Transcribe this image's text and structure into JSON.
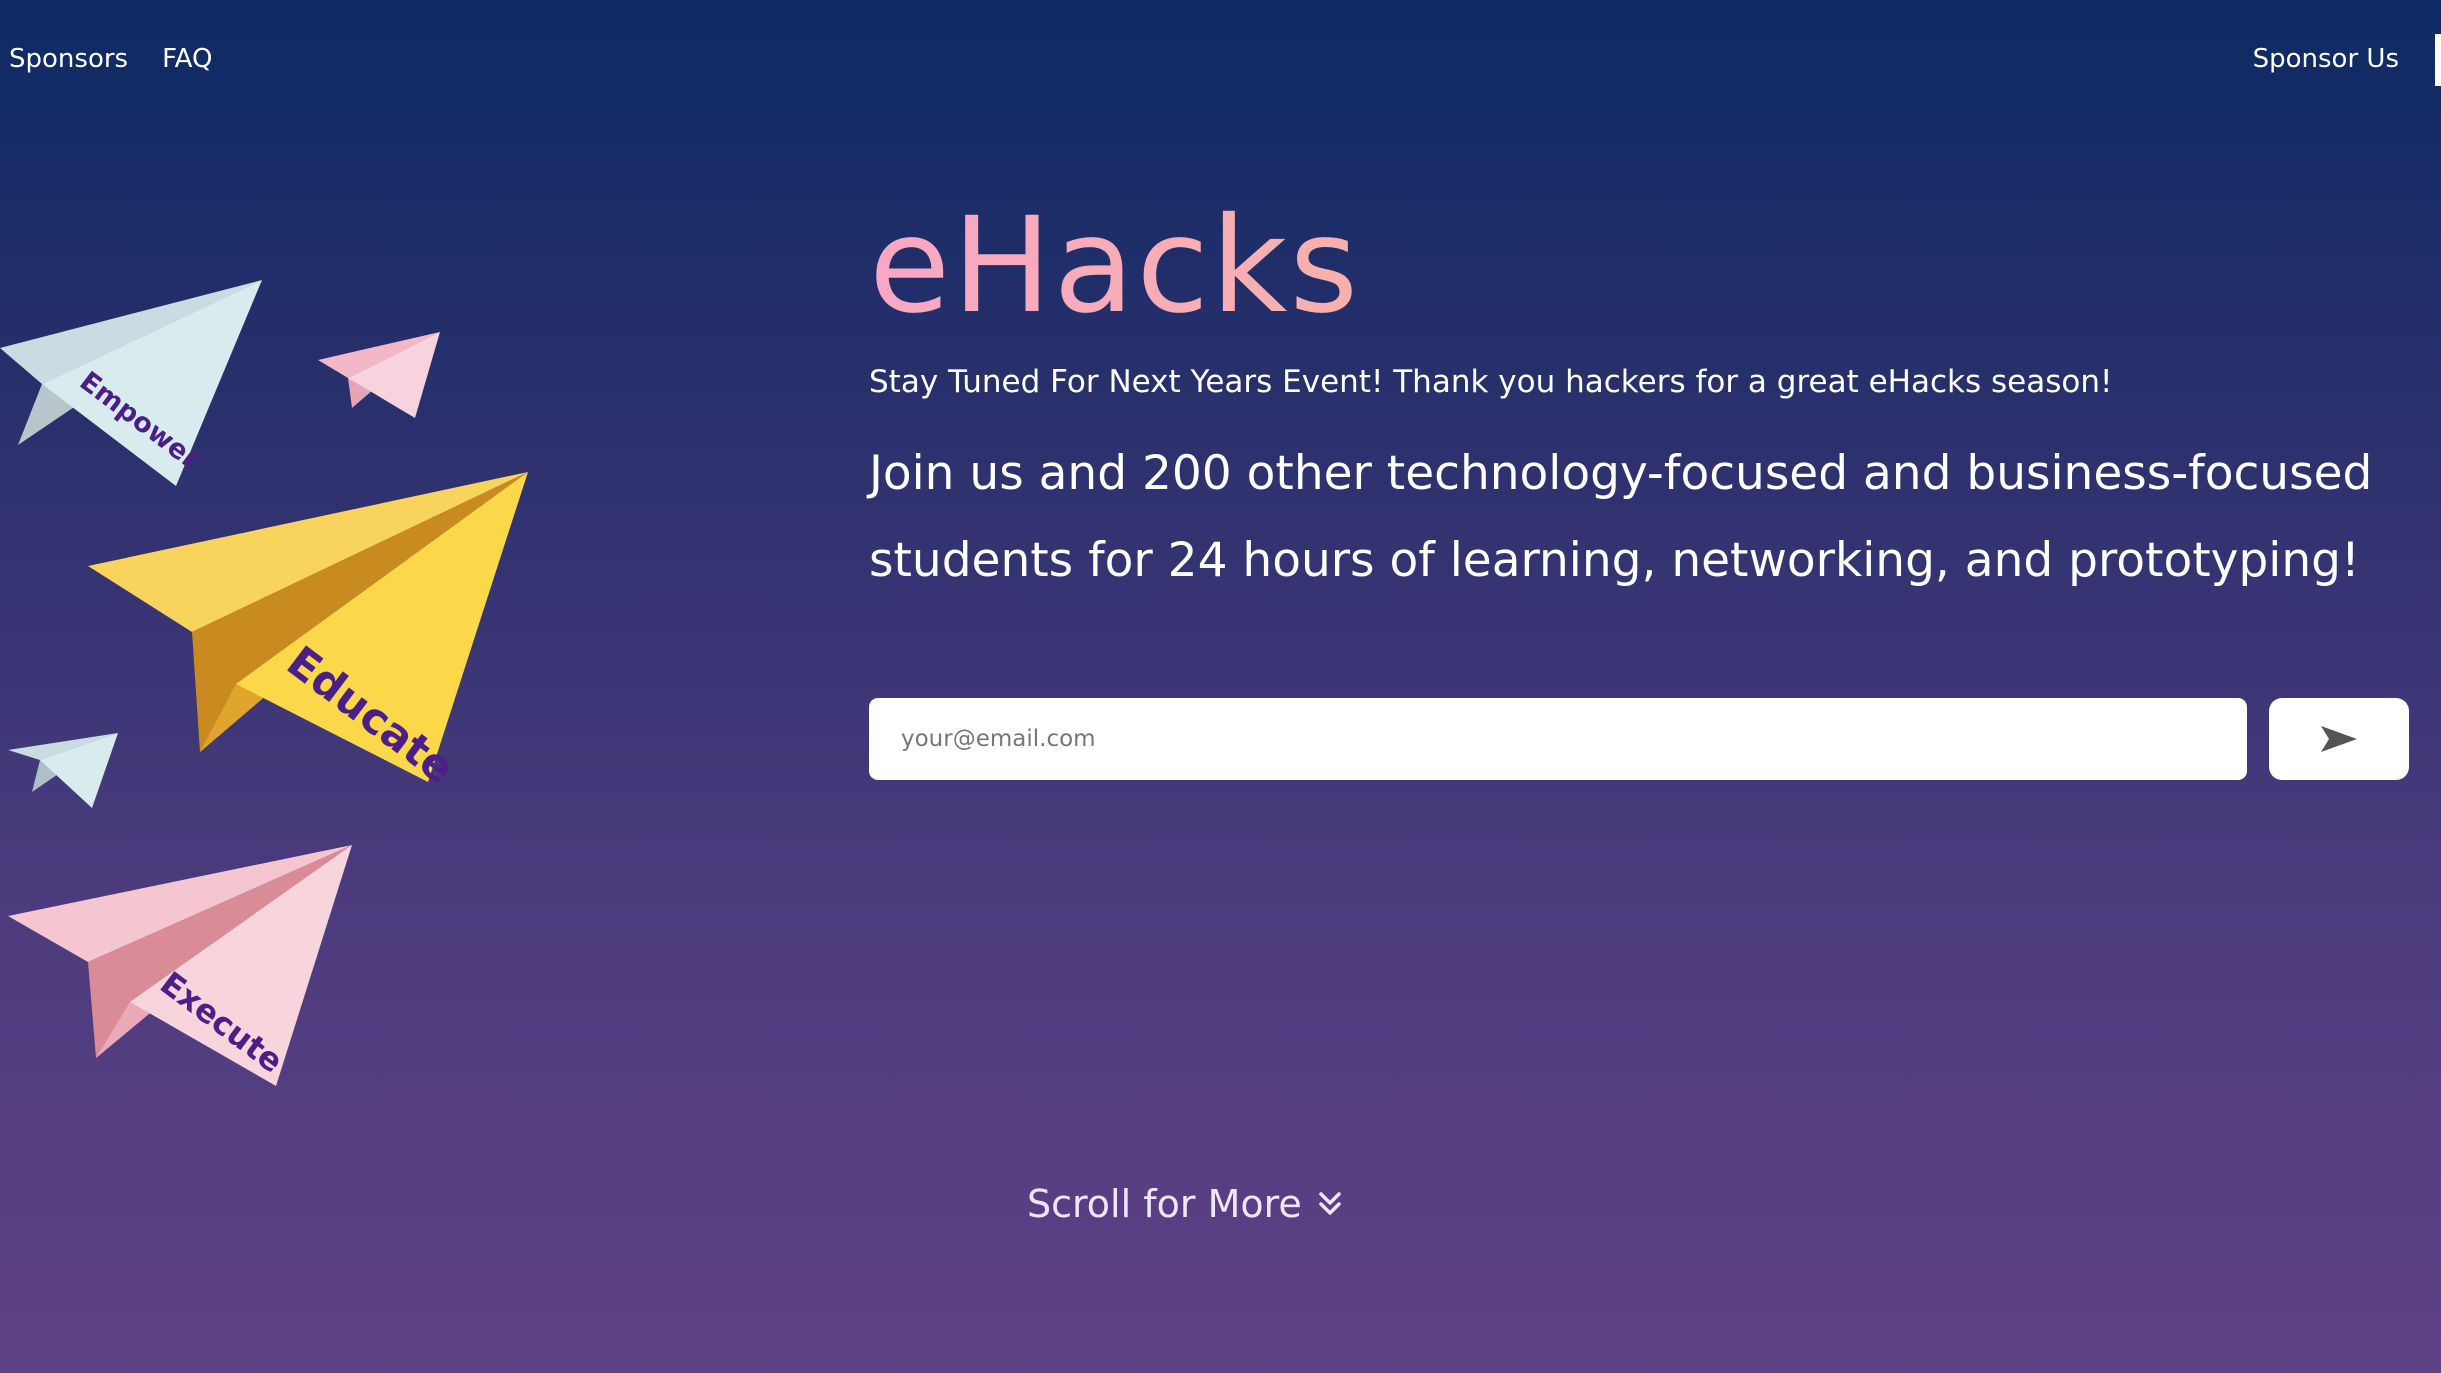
{
  "nav": {
    "left_links": [
      "Sponsors",
      "FAQ"
    ],
    "right_link": "Sponsor Us"
  },
  "planes": [
    {
      "label": "Empower",
      "color": "#d8ecf0"
    },
    {
      "label": "Educate",
      "color": "#f9c93a"
    },
    {
      "label": "Execute",
      "color": "#f7cfd8"
    }
  ],
  "hero": {
    "title": "eHacks",
    "note": "Stay Tuned For Next Years Event! Thank you hackers for a great eHacks season!",
    "pitch": "Join us and 200 other technology-focused and business-focused students for 24 hours of learning, networking, and prototyping!"
  },
  "signup": {
    "email_value": "",
    "email_placeholder": "your@email.com",
    "submit_icon": "send-arrow-icon"
  },
  "scroll": {
    "label": "Scroll for More",
    "icon": "double-chevron-down-icon"
  },
  "colors": {
    "title_gradient_start": "#f8a7c4",
    "title_gradient_end": "#f5bf86",
    "background_top": "#0d2a64",
    "background_bottom": "#5f4186",
    "plane_label": "#4b1f87"
  }
}
